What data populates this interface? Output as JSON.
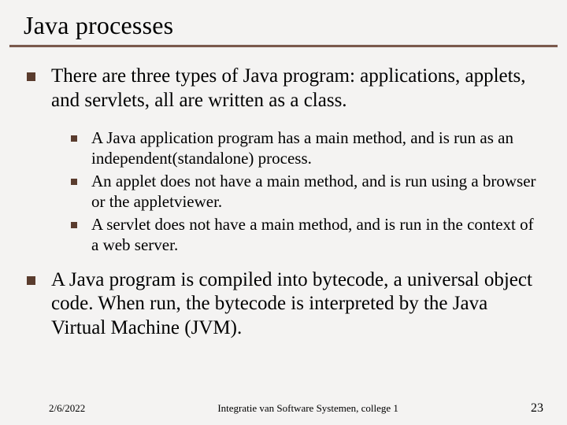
{
  "title": "Java processes",
  "bullets": [
    {
      "text": "There are three types of Java program: applications, applets, and servlets, all are written as a class.",
      "sub": [
        "A Java application program has a main method, and is run as an independent(standalone) process.",
        "An applet does not have a main method, and is run using a browser or the appletviewer.",
        "A servlet does not have a main method, and is run in the context of a web server."
      ]
    },
    {
      "text": "A Java program is compiled into bytecode, a universal object code.  When run, the bytecode is interpreted by the Java Virtual Machine (JVM).",
      "sub": []
    }
  ],
  "footer": {
    "date": "2/6/2022",
    "center": "Integratie van Software Systemen, college 1",
    "page": "23"
  }
}
